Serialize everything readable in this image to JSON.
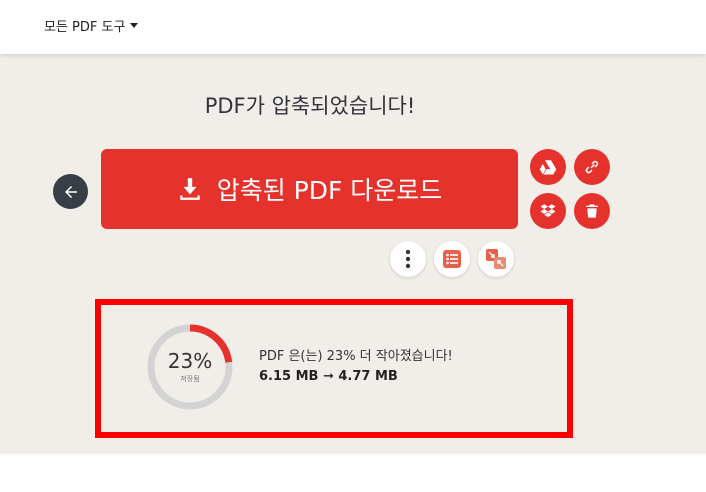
{
  "header": {
    "menu_label": "모든 PDF 도구"
  },
  "title": "PDF가 압축되었습니다!",
  "download_button": {
    "label": "압축된 PDF 다운로드"
  },
  "result": {
    "percent_text": "23%",
    "saved_label": "저장됨",
    "saved_fraction": 0.23,
    "message": "PDF 은(는) 23% 더 작아졌습니다!",
    "sizes": "6.15 MB ➞ 4.77 MB"
  },
  "colors": {
    "brand_red": "#e5322d",
    "background": "#f1eeea",
    "highlight_border": "#ff0000",
    "ring_track": "#d3d3d3"
  },
  "icons": [
    "arrow-left-icon",
    "download-icon",
    "google-drive-icon",
    "link-icon",
    "dropbox-icon",
    "trash-icon",
    "more-vertical-icon",
    "list-icon",
    "merge-compress-icon"
  ]
}
